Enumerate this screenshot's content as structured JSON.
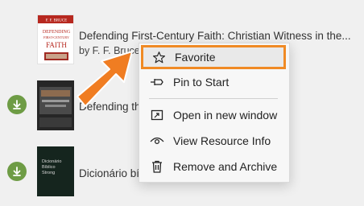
{
  "books": [
    {
      "title": "Defending First-Century Faith: Christian Witness in the...",
      "author": "by F. F. Bruce",
      "cover": {
        "line1": "F. F. BRUCE",
        "line2": "DEFENDING",
        "line3": "FIRST-CENTURY",
        "line4": "FAITH"
      },
      "downloaded": false
    },
    {
      "title": "Defending th",
      "author": "",
      "cover": {},
      "downloaded": true
    },
    {
      "title": "Dicionário bí",
      "author": "",
      "cover": {
        "line1": "Dicionário",
        "line2": "Bíblico",
        "line3": "Strong"
      },
      "downloaded": true
    }
  ],
  "context_menu": {
    "items": [
      {
        "label": "Favorite",
        "icon": "star-icon",
        "highlighted": true
      },
      {
        "label": "Pin to Start",
        "icon": "pin-icon"
      },
      {
        "label": "Open in new window",
        "icon": "new-window-icon"
      },
      {
        "label": "View Resource Info",
        "icon": "eye-icon"
      },
      {
        "label": "Remove and Archive",
        "icon": "trash-icon"
      }
    ]
  },
  "colors": {
    "highlight_border": "#f08a24",
    "arrow": "#f07d22",
    "download_badge": "#6e9c45"
  }
}
